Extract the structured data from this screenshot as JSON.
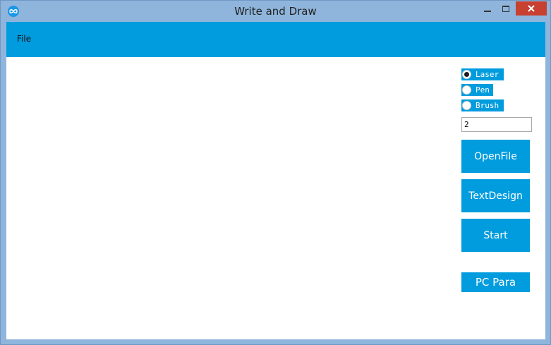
{
  "window": {
    "title": "Write and Draw",
    "app_icon": "infinity-icon"
  },
  "menu": {
    "file_label": "File"
  },
  "tools": [
    {
      "label": "Laser",
      "checked": true
    },
    {
      "label": "Pen",
      "checked": false
    },
    {
      "label": "Brush",
      "checked": false
    }
  ],
  "size_input": {
    "value": "2"
  },
  "buttons": {
    "open_file": "OpenFile",
    "text_design": "TextDesign",
    "start": "Start",
    "pc_para": "PC Para"
  },
  "colors": {
    "accent": "#019cde",
    "titlebar": "#8fb5dc",
    "close": "#c84030"
  }
}
